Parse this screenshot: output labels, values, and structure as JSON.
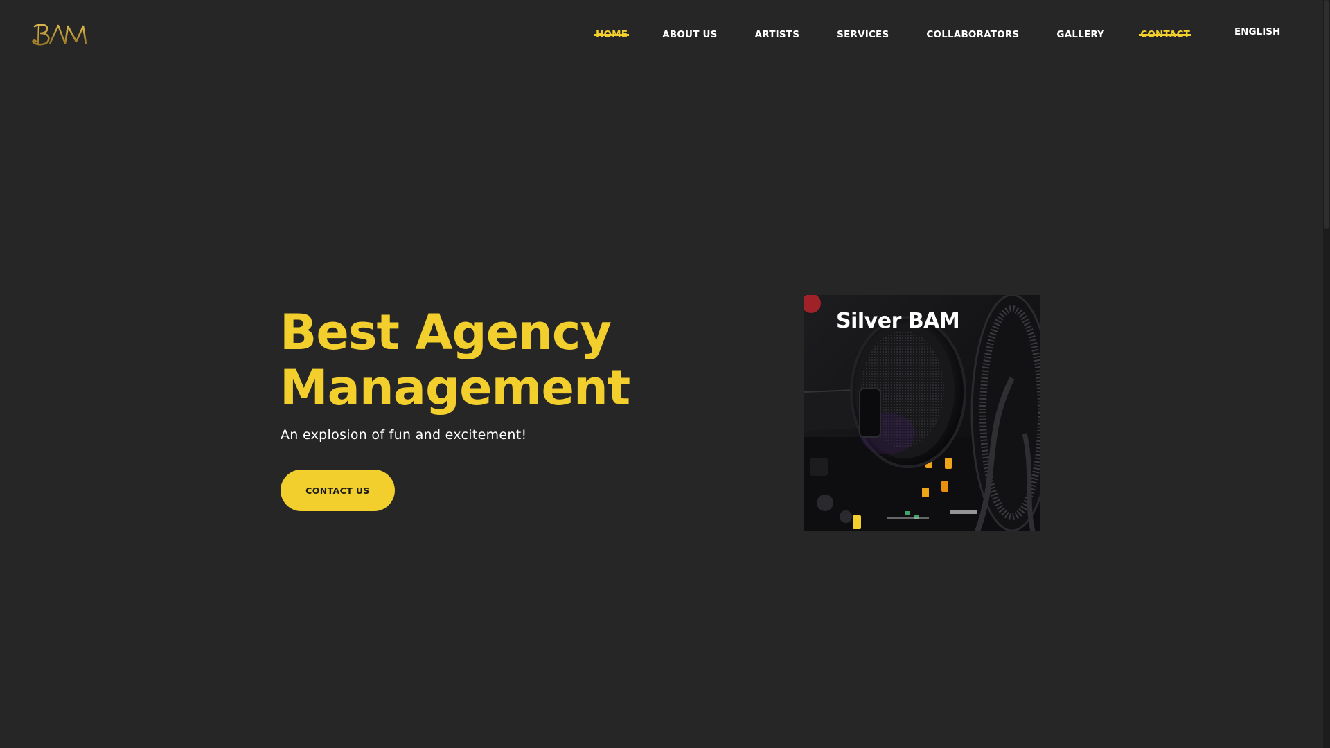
{
  "header": {
    "logo_text": "BAM",
    "nav": [
      {
        "label": "HOME",
        "active": true
      },
      {
        "label": "ABOUT US",
        "active": false
      },
      {
        "label": "ARTISTS",
        "active": false
      },
      {
        "label": "SERVICES",
        "active": false
      },
      {
        "label": "COLLABORATORS",
        "active": false
      },
      {
        "label": "GALLERY",
        "active": false
      },
      {
        "label": "CONTACT",
        "active": true
      }
    ],
    "language": "ENGLISH"
  },
  "hero": {
    "title_line1": "Best Agency",
    "title_line2": "Management",
    "subtitle": "An explosion of fun and excitement!",
    "cta_label": "CONTACT US"
  },
  "card": {
    "label": "Silver BAM",
    "image_icon": "dj-headphones-mixer-photo"
  },
  "colors": {
    "background": "#262626",
    "accent": "#f2cf2c",
    "text": "#ffffff",
    "logo_gold": "#b8922e"
  }
}
